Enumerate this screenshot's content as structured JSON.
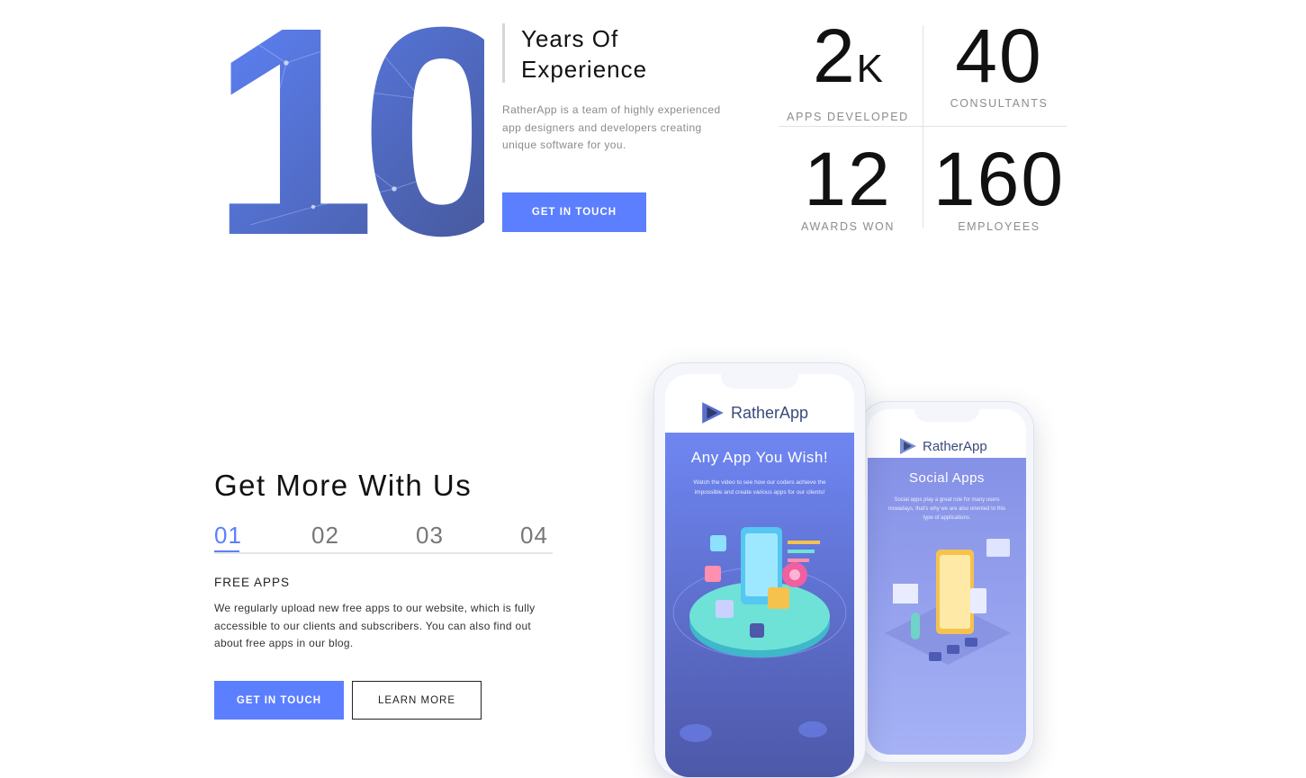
{
  "hero": {
    "big_number": "10",
    "years_title": "Years Of Experience",
    "description": "RatherApp is a team of highly experienced app designers and developers creating unique software for you.",
    "cta_label": "GET IN TOUCH"
  },
  "stats": [
    {
      "value": "2",
      "suffix": "K",
      "label": "APPS DEVELOPED"
    },
    {
      "value": "40",
      "suffix": "",
      "label": "CONSULTANTS"
    },
    {
      "value": "12",
      "suffix": "",
      "label": "AWARDS WON"
    },
    {
      "value": "160",
      "suffix": "",
      "label": "EMPLOYEES"
    }
  ],
  "features": {
    "title": "Get More With Us",
    "tabs": [
      "01",
      "02",
      "03",
      "04"
    ],
    "active_tab": "01",
    "item_title": "FREE APPS",
    "item_text": "We regularly upload new free apps to our website, which is fully accessible to our clients and subscribers. You can also find out about free apps in our blog.",
    "primary_button": "GET IN TOUCH",
    "secondary_button": "LEARN MORE"
  },
  "phones": {
    "front": {
      "brand": "RatherApp",
      "title": "Any App You Wish!",
      "text": "Watch the video to see how our coders achieve the impossible and create various apps for our clients!"
    },
    "back": {
      "brand": "RatherApp",
      "title": "Social Apps",
      "text": "Social apps play a great role for many users nowadays, that's why we are also oriented to this type of applications."
    }
  },
  "colors": {
    "accent": "#5b7fff",
    "text_dark": "#111111",
    "text_muted": "#8c8c8c"
  }
}
